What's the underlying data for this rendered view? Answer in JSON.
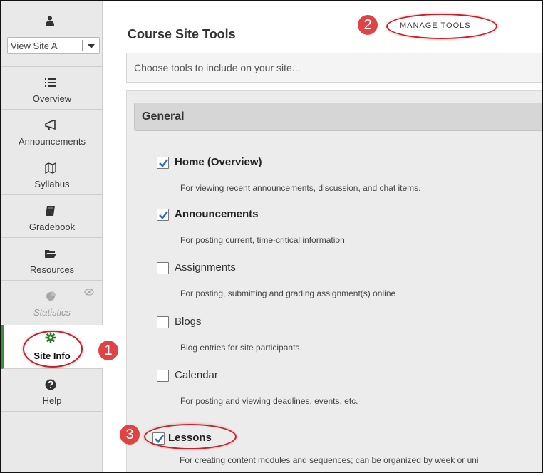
{
  "sidebar": {
    "site_select_label": "View Site A",
    "items": [
      {
        "key": "overview",
        "label": "Overview",
        "icon": "list-icon"
      },
      {
        "key": "announcements",
        "label": "Announcements",
        "icon": "megaphone-icon"
      },
      {
        "key": "syllabus",
        "label": "Syllabus",
        "icon": "map-icon"
      },
      {
        "key": "gradebook",
        "label": "Gradebook",
        "icon": "book-icon"
      },
      {
        "key": "resources",
        "label": "Resources",
        "icon": "folder-icon"
      },
      {
        "key": "statistics",
        "label": "Statistics",
        "icon": "pie-chart-icon",
        "disabled": true
      },
      {
        "key": "site-info",
        "label": "Site Info",
        "icon": "gear-icon",
        "active": true
      },
      {
        "key": "help",
        "label": "Help",
        "icon": "question-icon"
      }
    ]
  },
  "main": {
    "title": "Course Site Tools",
    "manage_tools_label": "MANAGE TOOLS",
    "search_prompt": "Choose tools to include on your site...",
    "section_title": "General",
    "tools": [
      {
        "label": "Home (Overview)",
        "desc": "For viewing recent announcements, discussion, and chat items.",
        "checked": true
      },
      {
        "label": "Announcements",
        "desc": "For posting current, time-critical information",
        "checked": true
      },
      {
        "label": "Assignments",
        "desc": "For posting, submitting and grading assignment(s) online",
        "checked": false
      },
      {
        "label": "Blogs",
        "desc": "Blog entries for site participants.",
        "checked": false
      },
      {
        "label": "Calendar",
        "desc": "For posting and viewing deadlines, events, etc.",
        "checked": false
      },
      {
        "label": "Lessons",
        "desc": "For creating content modules and sequences; can be organized by week or uni",
        "checked": true
      }
    ]
  },
  "callouts": [
    "1",
    "2",
    "3"
  ],
  "colors": {
    "accent_green": "#3c8f3c",
    "callout_red": "#e04343",
    "check_blue": "#2f6fbf"
  }
}
